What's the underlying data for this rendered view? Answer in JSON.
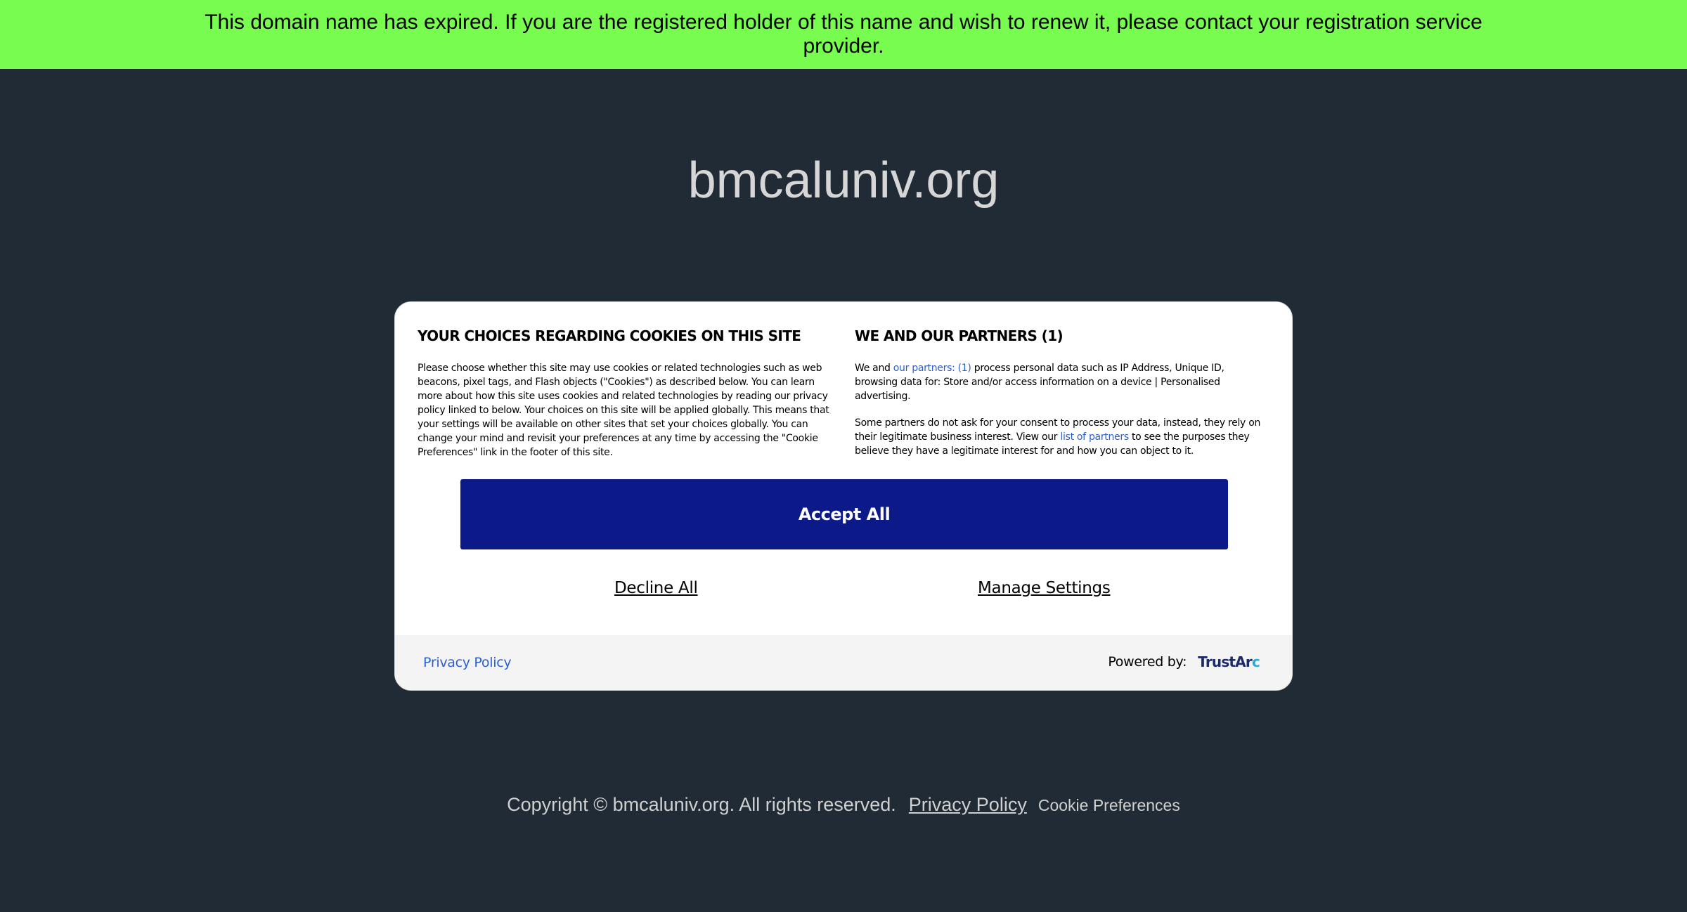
{
  "banner": {
    "message": "This domain name has expired. If you are the registered holder of this name and wish to renew it, please contact your registration service provider."
  },
  "page": {
    "domain": "bmcaluniv.org"
  },
  "cookie_dialog": {
    "left": {
      "heading": "YOUR CHOICES REGARDING COOKIES ON THIS SITE",
      "body": "Please choose whether this site may use cookies or related technologies such as web beacons, pixel tags, and Flash objects (\"Cookies\") as described below. You can learn more about how this site uses cookies and related technologies by reading our privacy policy linked to below. Your choices on this site will be applied globally. This means that your settings will be available on other sites that set your choices globally. You can change your mind and revisit your preferences at any time by accessing the \"Cookie Preferences\" link in the footer of this site."
    },
    "right": {
      "heading": "WE AND OUR PARTNERS (1)",
      "p1_before": "We and ",
      "p1_link": "our partners: (1)",
      "p1_after": " process personal data such as IP Address, Unique ID, browsing data for: Store and/or access information on a device | Personalised advertising.",
      "p2_before": "Some partners do not ask for your consent to process your data, instead, they rely on their legitimate business interest. View our ",
      "p2_link": "list of partners",
      "p2_after": " to see the purposes they believe they have a legitimate interest for and how you can object to it."
    },
    "accept_label": "Accept All",
    "decline_label": "Decline All",
    "manage_label": "Manage Settings",
    "footer": {
      "privacy_label": "Privacy Policy",
      "powered_by": "Powered by:",
      "logo_main": "TrustAr",
      "logo_accent": "c"
    }
  },
  "footer": {
    "copyright": "Copyright © bmcaluniv.org.  All rights reserved.",
    "privacy_label": "Privacy Policy",
    "cookie_label": "Cookie Preferences"
  },
  "colors": {
    "banner_bg": "#77fc4f",
    "page_bg": "#212b35",
    "accept_bg": "#0b1a88",
    "link": "#2d5fcc"
  }
}
